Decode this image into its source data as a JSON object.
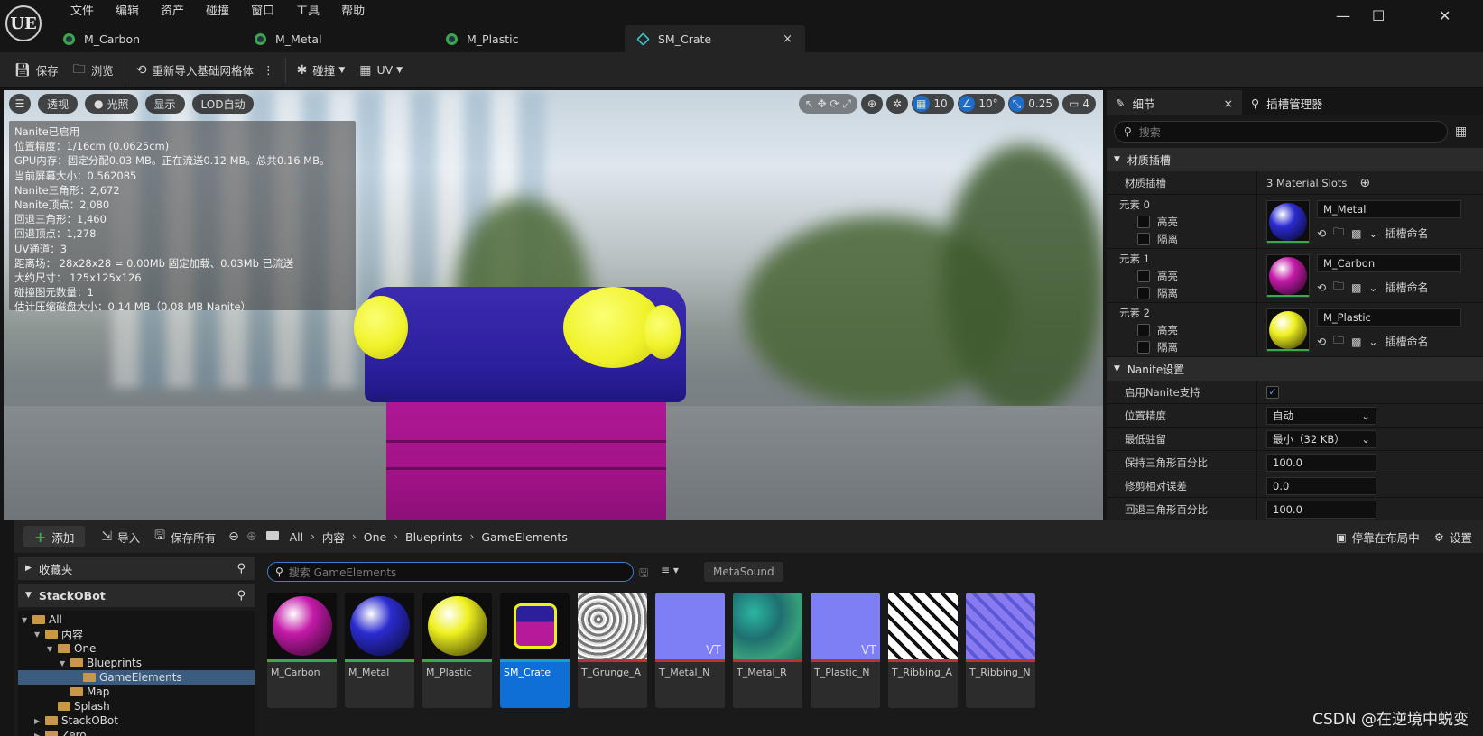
{
  "app": {
    "logo": "UE",
    "menu": [
      "文件",
      "编辑",
      "资产",
      "碰撞",
      "窗口",
      "工具",
      "帮助"
    ],
    "window_controls": {
      "minimize": "—",
      "maximize": "☐",
      "close": "✕"
    },
    "tabs": [
      {
        "label": "M_Carbon",
        "active": false
      },
      {
        "label": "M_Metal",
        "active": false
      },
      {
        "label": "M_Plastic",
        "active": false
      },
      {
        "label": "SM_Crate",
        "active": true
      }
    ],
    "tab_close": "×"
  },
  "toolbar": {
    "save": "保存",
    "browse": "浏览",
    "reimport": "重新导入基础网格体",
    "collision": "碰撞",
    "uv": "UV"
  },
  "viewport": {
    "buttons": {
      "perspective": "透视",
      "lighting": "光照",
      "show": "显示",
      "lod": "LOD自动"
    },
    "right": {
      "grid_value": "10",
      "angle_value": "10°",
      "scale_value": "0.25",
      "camera_value": "4"
    },
    "stats": [
      "Nanite已启用",
      "位置精度：1/16cm (0.0625cm)",
      "GPU内存：固定分配0.03 MB。正在流送0.12 MB。总共0.16 MB。",
      "当前屏幕大小：0.562085",
      "Nanite三角形：2,672",
      "Nanite顶点：2,080",
      "回退三角形：1,460",
      "回退顶点：1,278",
      "UV通道：3",
      "距离场： 28x28x28 = 0.00Mb 固定加载、0.03Mb 已流送",
      "大约尺寸： 125x125x126",
      "碰撞图元数量：1",
      "估计压缩磁盘大小：0.14 MB（0.08 MB Nanite）"
    ]
  },
  "details": {
    "tab_details": "细节",
    "tab_close": "×",
    "tab_sockets": "插槽管理器",
    "search_placeholder": "搜索",
    "section_material_slots": "材质插槽",
    "material_slots_label": "材质插槽",
    "material_slots_value": "3 Material Slots",
    "highlight": "高亮",
    "isolate": "隔离",
    "slot_name_label": "插槽命名",
    "elements": [
      {
        "label": "元素 0",
        "material": "M_Metal",
        "color": "#2b2bd0"
      },
      {
        "label": "元素 1",
        "material": "M_Carbon",
        "color": "#c41aa8"
      },
      {
        "label": "元素 2",
        "material": "M_Plastic",
        "color": "#eef01e"
      }
    ],
    "section_nanite": "Nanite设置",
    "nanite_rows": [
      {
        "label": "启用Nanite支持",
        "type": "check",
        "value": "✓"
      },
      {
        "label": "位置精度",
        "type": "select",
        "value": "自动"
      },
      {
        "label": "最低驻留",
        "type": "select",
        "value": "最小（32 KB）"
      },
      {
        "label": "保持三角形百分比",
        "type": "num",
        "value": "100.0"
      },
      {
        "label": "修剪相对误差",
        "type": "num",
        "value": "0.0"
      },
      {
        "label": "回退三角形百分比",
        "type": "num",
        "value": "100.0"
      }
    ]
  },
  "content_browser": {
    "add": "添加",
    "import": "导入",
    "save_all": "保存所有",
    "breadcrumb": [
      "All",
      "内容",
      "One",
      "Blueprints",
      "GameElements"
    ],
    "dock": "停靠在布局中",
    "settings": "设置",
    "favorites": "收藏夹",
    "project": "StackOBot",
    "tree": [
      {
        "label": "All",
        "depth": 0,
        "selected": false
      },
      {
        "label": "内容",
        "depth": 1,
        "selected": false
      },
      {
        "label": "One",
        "depth": 2,
        "selected": false
      },
      {
        "label": "Blueprints",
        "depth": 3,
        "selected": false
      },
      {
        "label": "GameElements",
        "depth": 4,
        "selected": true
      },
      {
        "label": "Map",
        "depth": 3,
        "selected": false
      },
      {
        "label": "Splash",
        "depth": 2,
        "selected": false
      },
      {
        "label": "StackOBot",
        "depth": 1,
        "selected": false
      },
      {
        "label": "Zero",
        "depth": 1,
        "selected": false
      }
    ],
    "search_placeholder": "搜索 GameElements",
    "filter_chip": "MetaSound",
    "assets": [
      {
        "name": "M_Carbon",
        "kind": "material",
        "color": "#c41aa8",
        "strip": "#3ba84b"
      },
      {
        "name": "M_Metal",
        "kind": "material",
        "color": "#2b2bd0",
        "strip": "#3ba84b"
      },
      {
        "name": "M_Plastic",
        "kind": "material",
        "color": "#eef01e",
        "strip": "#3ba84b"
      },
      {
        "name": "SM_Crate",
        "kind": "mesh",
        "color": "#b51a9a",
        "strip": "#1c9ad6"
      },
      {
        "name": "T_Grunge_A",
        "kind": "texture",
        "color": "#dcdcdc",
        "strip": "#c03030"
      },
      {
        "name": "T_Metal_N",
        "kind": "texture_vt",
        "color": "#7f7ff5",
        "strip": "#c03030"
      },
      {
        "name": "T_Metal_R",
        "kind": "texture",
        "color": "#3fa880",
        "strip": "#c03030"
      },
      {
        "name": "T_Plastic_N",
        "kind": "texture_vt",
        "color": "#7f7ff5",
        "strip": "#c03030"
      },
      {
        "name": "T_Ribbing_A",
        "kind": "texture",
        "color": "#e6e6e6",
        "strip": "#c03030"
      },
      {
        "name": "T_Ribbing_N",
        "kind": "texture",
        "color": "#7a6be6",
        "strip": "#c03030"
      }
    ],
    "vt_badge": "VT"
  },
  "watermark": "CSDN @在逆境中蜕变"
}
